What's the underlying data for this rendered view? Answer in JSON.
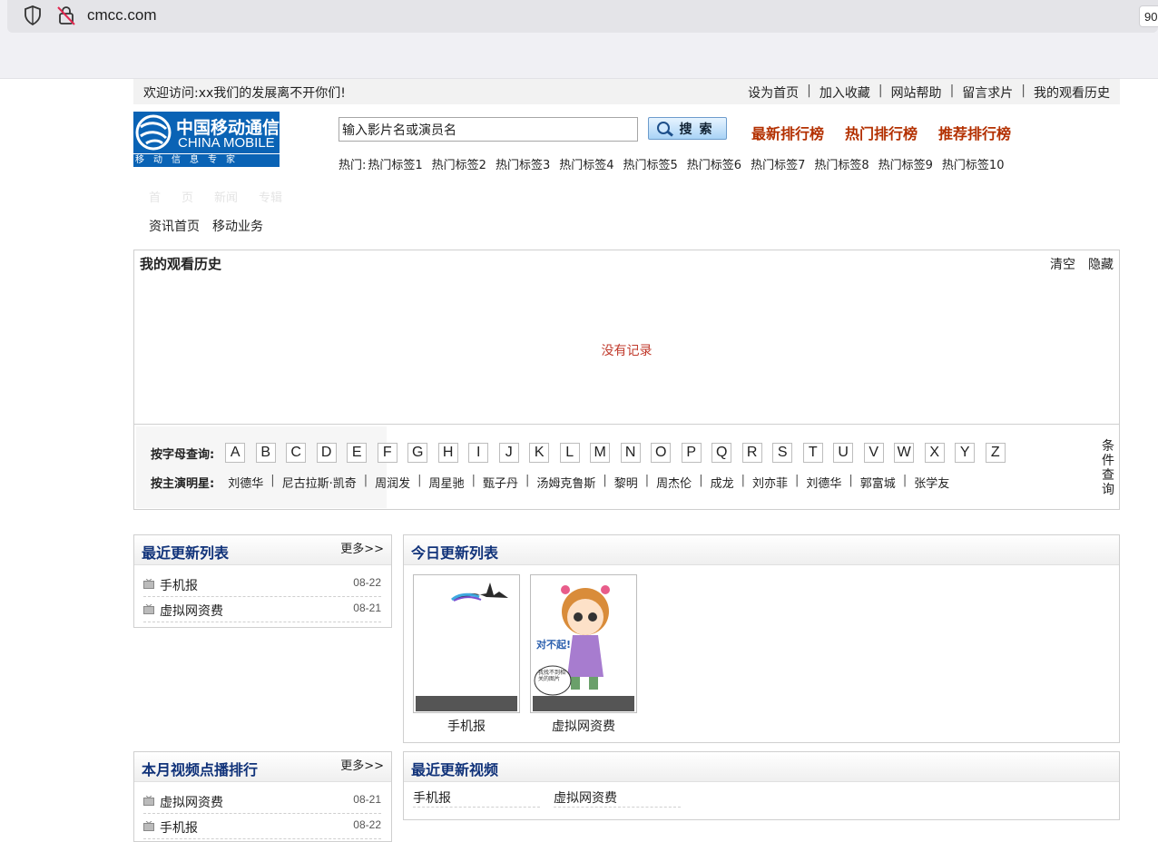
{
  "browser": {
    "url": "cmcc.com",
    "zoom": "90"
  },
  "topbar": {
    "welcome": "欢迎访问:xx我们的发展离不开你们!",
    "links": [
      "设为首页",
      "加入收藏",
      "网站帮助",
      "留言求片",
      "我的观看历史"
    ]
  },
  "logo": {
    "cn": "中国移动通信",
    "en": "CHINA MOBILE",
    "slogan": "移动信息专家"
  },
  "search": {
    "value": "输入影片名或演员名",
    "button": "搜索"
  },
  "ranks": [
    "最新排行榜",
    "热门排行榜",
    "推荐排行榜"
  ],
  "hot": {
    "label": "热门:",
    "tags": [
      "热门标签1",
      "热门标签2",
      "热门标签3",
      "热门标签4",
      "热门标签5",
      "热门标签6",
      "热门标签7",
      "热门标签8",
      "热门标签9",
      "热门标签10"
    ]
  },
  "ghost_nav": [
    "首",
    "页",
    "新闻",
    "专辑"
  ],
  "nav": [
    "资讯首页",
    "移动业务"
  ],
  "history": {
    "title": "我的观看历史",
    "clear": "清空",
    "hide": "隐藏",
    "empty": "没有记录"
  },
  "letter_search": {
    "label": "按字母查询:",
    "letters": [
      "A",
      "B",
      "C",
      "D",
      "E",
      "F",
      "G",
      "H",
      "I",
      "J",
      "K",
      "L",
      "M",
      "N",
      "O",
      "P",
      "Q",
      "R",
      "S",
      "T",
      "U",
      "V",
      "W",
      "X",
      "Y",
      "Z"
    ],
    "star_label": "按主演明星:",
    "stars": [
      "刘德华",
      "尼古拉斯·凯奇",
      "周润发",
      "周星驰",
      "甄子丹",
      "汤姆克鲁斯",
      "黎明",
      "周杰伦",
      "成龙",
      "刘亦菲",
      "刘德华",
      "郭富城",
      "张学友"
    ],
    "condition": "条件查询"
  },
  "recent": {
    "title": "最近更新列表",
    "more": "更多>>",
    "items": [
      {
        "name": "手机报",
        "date": "08-22"
      },
      {
        "name": "虚拟网资费",
        "date": "08-21"
      }
    ]
  },
  "today": {
    "title": "今日更新列表",
    "items": [
      {
        "name": "手机报"
      },
      {
        "name": "虚拟网资费"
      }
    ],
    "placeholder_text": [
      "对不起!",
      "我找不到相关的图片"
    ]
  },
  "monthly": {
    "title": "本月视频点播排行",
    "more": "更多>>",
    "items": [
      {
        "name": "虚拟网资费",
        "date": "08-21"
      },
      {
        "name": "手机报",
        "date": "08-22"
      }
    ]
  },
  "recent_videos": {
    "title": "最近更新视频",
    "items": [
      "手机报",
      "虚拟网资费"
    ]
  }
}
